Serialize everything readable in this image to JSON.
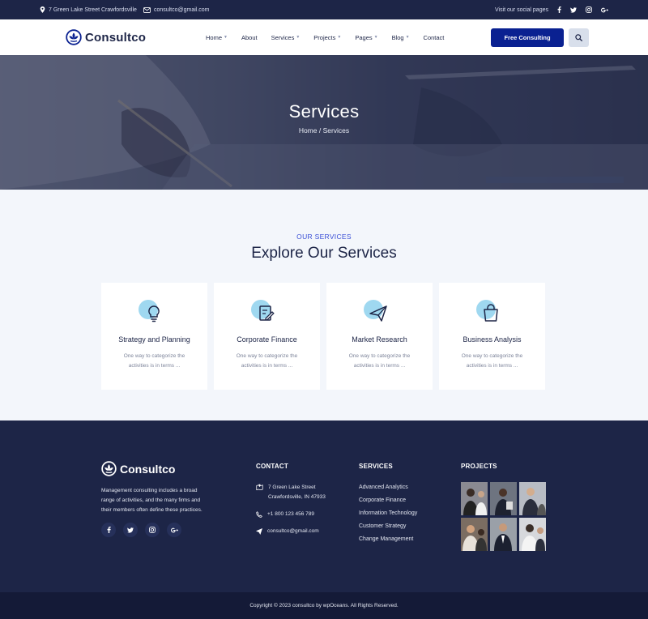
{
  "topbar": {
    "address": "7 Green Lake Street Crawfordsville",
    "email": "consultco@gmail.com",
    "social_label": "Visit our social pages",
    "social_icons": [
      "facebook-icon",
      "twitter-icon",
      "instagram-icon",
      "google-plus-icon"
    ]
  },
  "header": {
    "logo_text": "Consultco",
    "nav": [
      {
        "label": "Home",
        "has_caret": true
      },
      {
        "label": "About",
        "has_caret": false
      },
      {
        "label": "Services",
        "has_caret": true
      },
      {
        "label": "Projects",
        "has_caret": true
      },
      {
        "label": "Pages",
        "has_caret": true
      },
      {
        "label": "Blog",
        "has_caret": true
      },
      {
        "label": "Contact",
        "has_caret": false
      }
    ],
    "cta_label": "Free Consulting",
    "search_icon": "search-icon"
  },
  "hero": {
    "title": "Services",
    "breadcrumb": "Home / Services"
  },
  "services": {
    "eyebrow": "OUR SERVICES",
    "title": "Explore Our Services",
    "cards": [
      {
        "title": "Strategy and Planning",
        "desc": "One way to categorize the activities is in terms ...",
        "icon": "lightbulb-icon"
      },
      {
        "title": "Corporate Finance",
        "desc": "One way to categorize the activities is in terms ...",
        "icon": "document-edit-icon"
      },
      {
        "title": "Market Research",
        "desc": "One way to categorize the activities is in terms ...",
        "icon": "paper-plane-icon"
      },
      {
        "title": "Business Analysis",
        "desc": "One way to categorize the activities is in terms ...",
        "icon": "shopping-bag-icon"
      }
    ]
  },
  "footer": {
    "logo_text": "Consultco",
    "description": "Management consulting includes a broad range of activities, and the many firms and their members often define these practices.",
    "contact_title": "CONTACT",
    "contact": {
      "address_line1": "7 Green Lake Street",
      "address_line2": "Crawfordsville, IN 47933",
      "phone": "+1 800 123 456 789",
      "email": "consultco@gmail.com"
    },
    "services_title": "SERVICES",
    "services": [
      "Advanced Analytics",
      "Corporate Finance",
      "Information Technology",
      "Customer Strategy",
      "Change Management"
    ],
    "projects_title": "PROJECTS",
    "copyright": "Copyright © 2023 consultco by wpOceans. All Rights Reserved."
  },
  "colors": {
    "navy": "#1d2547",
    "accent_blue": "#0a2191",
    "eyebrow_blue": "#3a4fd6",
    "icon_circle": "#9fd8f0"
  }
}
